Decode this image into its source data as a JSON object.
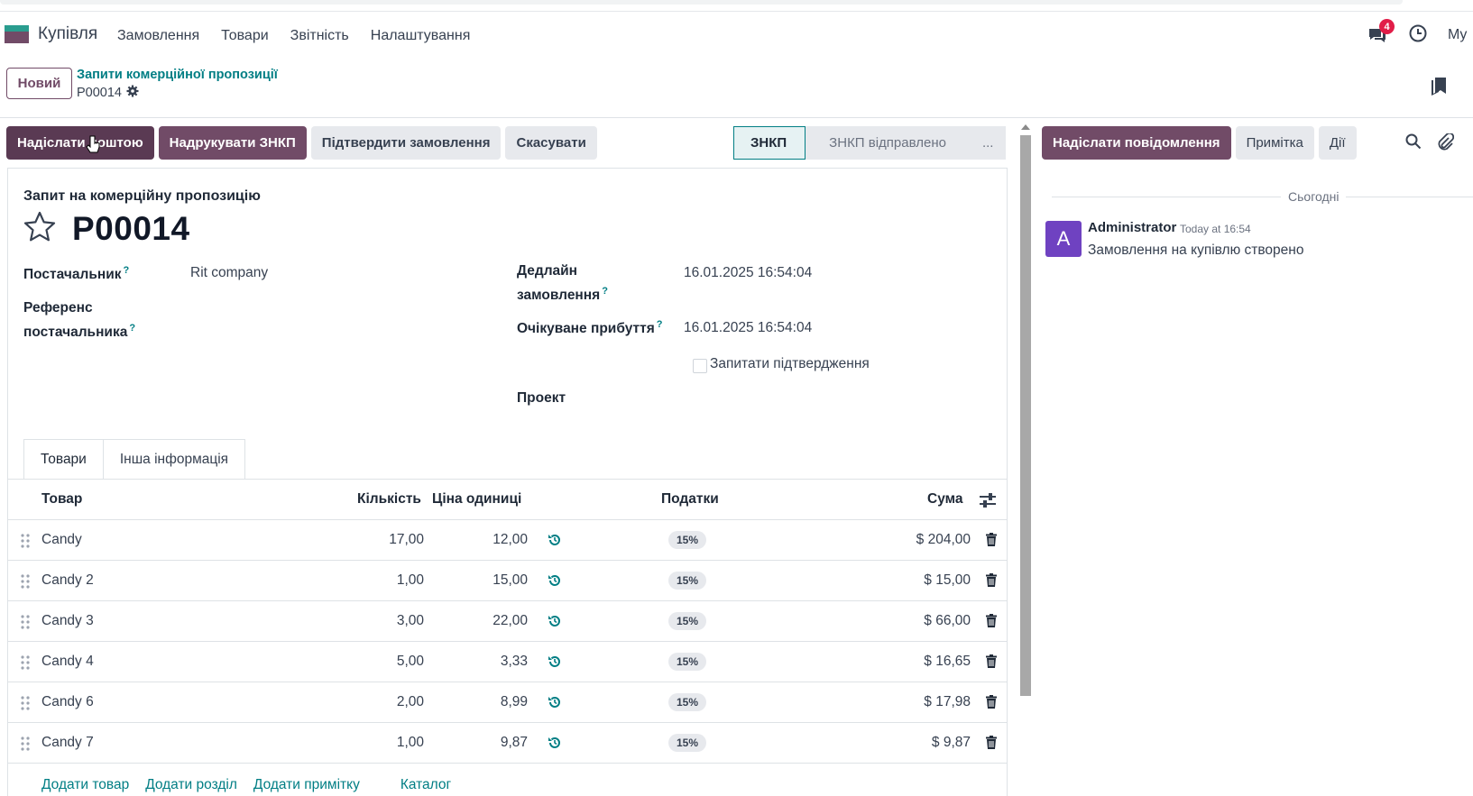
{
  "app": {
    "name": "Купівля"
  },
  "menu": [
    "Замовлення",
    "Товари",
    "Звітність",
    "Налаштування"
  ],
  "nav": {
    "chat_badge": "4",
    "user_label": "My"
  },
  "control": {
    "new_button": "Новий",
    "breadcrumb_parent": "Запити комерційної пропозиції",
    "breadcrumb_current": "P00014"
  },
  "actions": {
    "send_email": "Надіслати поштою",
    "print_rfq": "Надрукувати ЗНКП",
    "confirm_order": "Підтвердити замовлення",
    "cancel": "Скасувати"
  },
  "stages": {
    "active": "ЗНКП",
    "next": "ЗНКП відправлено",
    "more": "..."
  },
  "form": {
    "doc_type": "Запит на комерційну пропозицію",
    "title": "P00014",
    "vendor_label": "Постачальник",
    "vendor_value": "Rit company",
    "vendor_ref_label_1": "Референс",
    "vendor_ref_label_2": "постачальника",
    "deadline_label_1": "Дедлайн",
    "deadline_label_2": "замовлення",
    "deadline_value": "16.01.2025 16:54:04",
    "expected_label": "Очікуване прибуття",
    "expected_value": "16.01.2025 16:54:04",
    "ask_confirmation": "Запитати підтвердження",
    "project_label": "Проект",
    "help_mark": "?"
  },
  "tabs": [
    "Товари",
    "Інша інформація"
  ],
  "table": {
    "headers": {
      "product": "Товар",
      "qty": "Кількість",
      "unit_price": "Ціна одиниці",
      "taxes": "Податки",
      "amount": "Сума"
    },
    "rows": [
      {
        "product": "Candy",
        "qty": "17,00",
        "price": "12,00",
        "tax": "15%",
        "amount": "$ 204,00"
      },
      {
        "product": "Candy 2",
        "qty": "1,00",
        "price": "15,00",
        "tax": "15%",
        "amount": "$ 15,00"
      },
      {
        "product": "Candy 3",
        "qty": "3,00",
        "price": "22,00",
        "tax": "15%",
        "amount": "$ 66,00"
      },
      {
        "product": "Candy 4",
        "qty": "5,00",
        "price": "3,33",
        "tax": "15%",
        "amount": "$ 16,65"
      },
      {
        "product": "Candy 6",
        "qty": "2,00",
        "price": "8,99",
        "tax": "15%",
        "amount": "$ 17,98"
      },
      {
        "product": "Candy 7",
        "qty": "1,00",
        "price": "9,87",
        "tax": "15%",
        "amount": "$ 9,87"
      }
    ],
    "add_links": [
      "Додати товар",
      "Додати розділ",
      "Додати примітку",
      "Каталог"
    ]
  },
  "chatter": {
    "send_message": "Надіслати повідомлення",
    "log_note": "Примітка",
    "activities": "Дії",
    "today": "Сьогодні",
    "avatar_letter": "A",
    "author": "Administrator",
    "date": "Today at 16:54",
    "body": "Замовлення на купівлю створено"
  },
  "colors": {
    "primary": "#714b67",
    "accent": "#017e84",
    "avatar": "#6f42c1",
    "badge": "#e11d48"
  }
}
